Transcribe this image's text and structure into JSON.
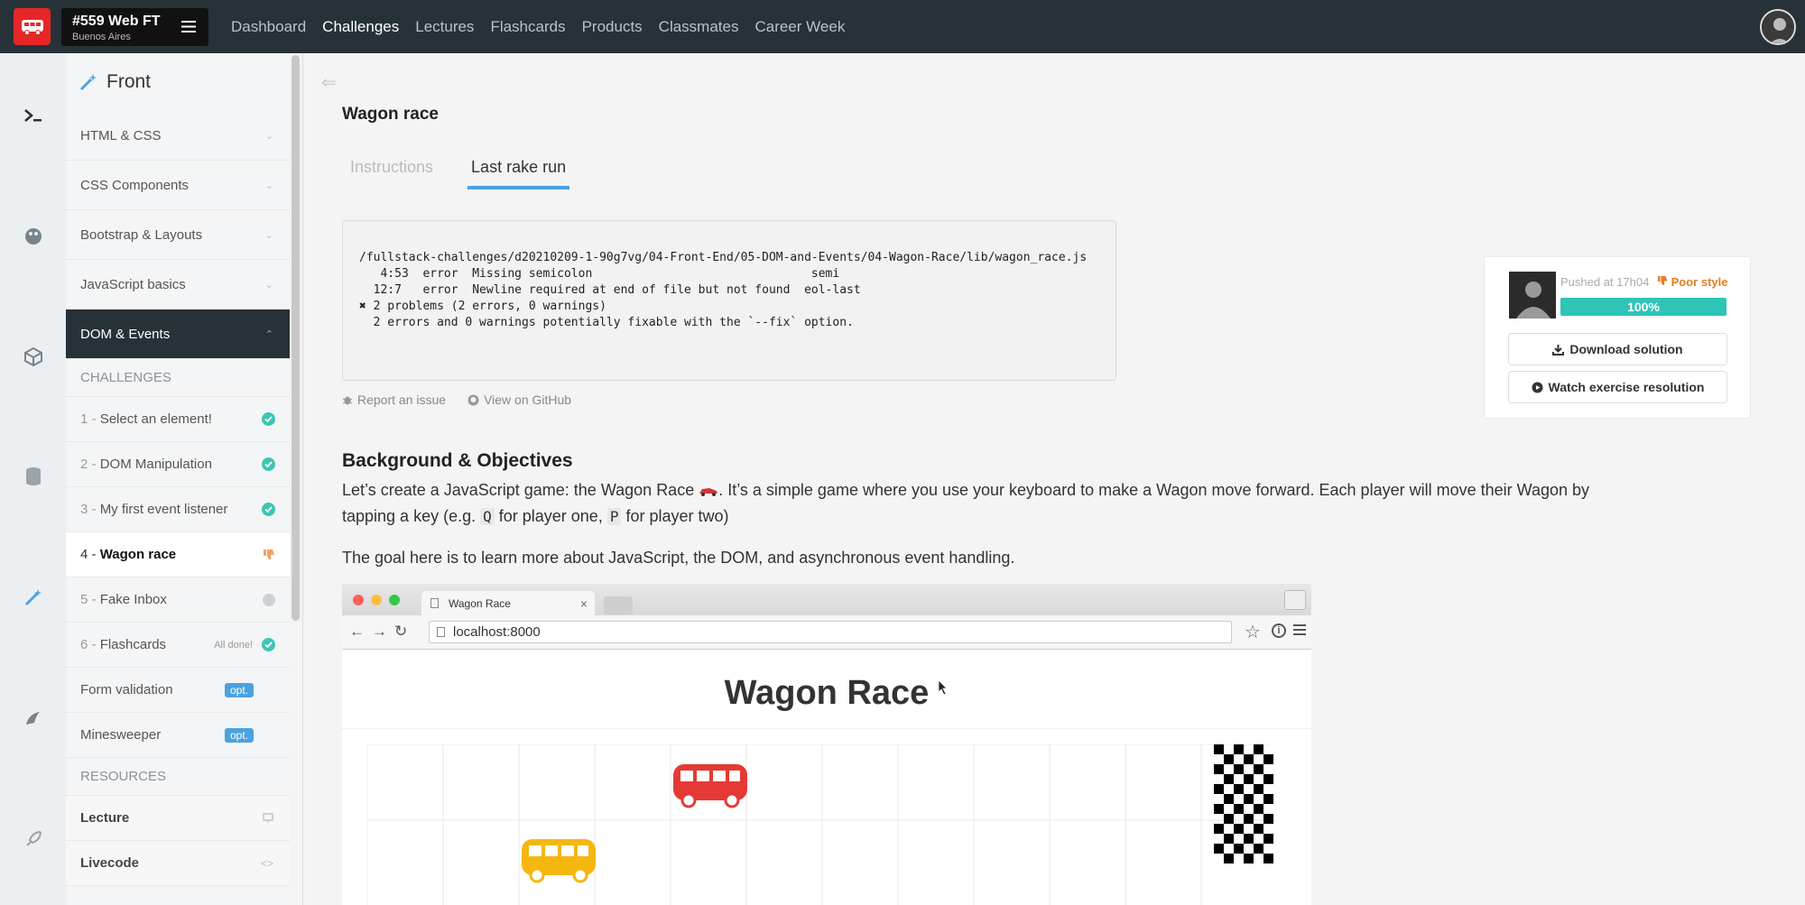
{
  "topbar": {
    "batch_number": "#559 Web FT",
    "batch_city": "Buenos Aires",
    "nav": [
      "Dashboard",
      "Challenges",
      "Lectures",
      "Flashcards",
      "Products",
      "Classmates",
      "Career Week"
    ],
    "active_nav": "Challenges"
  },
  "sidebar": {
    "module_title": "Front",
    "sections": [
      "HTML & CSS",
      "CSS Components",
      "Bootstrap & Layouts",
      "JavaScript basics"
    ],
    "active_section": "DOM & Events",
    "challenges_caption": "CHALLENGES",
    "challenges": [
      {
        "prefix": "1 - ",
        "label": "Select an element!",
        "status": "done"
      },
      {
        "prefix": "2 - ",
        "label": "DOM Manipulation",
        "status": "done"
      },
      {
        "prefix": "3 - ",
        "label": "My first event listener",
        "status": "done"
      },
      {
        "prefix": "4 - ",
        "label": "Wagon race",
        "status": "poor"
      },
      {
        "prefix": "5 - ",
        "label": "Fake Inbox",
        "status": "pending"
      },
      {
        "prefix": "6 - ",
        "label": "Flashcards",
        "status": "done",
        "note": "All done!"
      },
      {
        "prefix": "",
        "label": "Form validation",
        "status": "optional",
        "badge": "opt."
      },
      {
        "prefix": "",
        "label": "Minesweeper",
        "status": "optional",
        "badge": "opt."
      }
    ],
    "resources_caption": "RESOURCES",
    "resources": [
      "Lecture",
      "Livecode"
    ]
  },
  "main": {
    "title": "Wagon race",
    "tabs": [
      "Instructions",
      "Last rake run"
    ],
    "active_tab": "Last rake run",
    "console_lines": [
      "/fullstack-challenges/d20210209-1-90g7vg/04-Front-End/05-DOM-and-Events/04-Wagon-Race/lib/wagon_race.js",
      "   4:53  error  Missing semicolon                               semi",
      "  12:7   error  Newline required at end of file but not found  eol-last",
      "",
      "✖ 2 problems (2 errors, 0 warnings)",
      "  2 errors and 0 warnings potentially fixable with the `--fix` option."
    ],
    "report_link": "Report an issue",
    "github_link": "View on GitHub",
    "heading": "Background & Objectives",
    "para1_before": "Let’s create a JavaScript game: the Wagon Race ",
    "para1_after": ". It’s a simple game where you use your keyboard to make a Wagon move forward. Each player will move their Wagon by tapping a key (e.g. ",
    "key_q": "Q",
    "para1_mid": " for player one, ",
    "key_p": "P",
    "para1_end": " for player two)",
    "para2": "The goal here is to learn more about JavaScript, the DOM, and asynchronous event handling."
  },
  "screenshot": {
    "tab_title": "Wagon Race",
    "url": "localhost:8000",
    "game_title": "Wagon Race"
  },
  "panel": {
    "pushed": "Pushed at 17h04",
    "style_badge": "Poor style",
    "progress_label": "100%",
    "progress_value": 100,
    "download_label": "Download solution",
    "watch_label": "Watch exercise resolution"
  },
  "colors": {
    "accent_blue": "#4aa3df",
    "success_teal": "#3ec6b2",
    "warning_orange": "#e67e22",
    "brand_red": "#e62727",
    "navbar": "#263238"
  }
}
